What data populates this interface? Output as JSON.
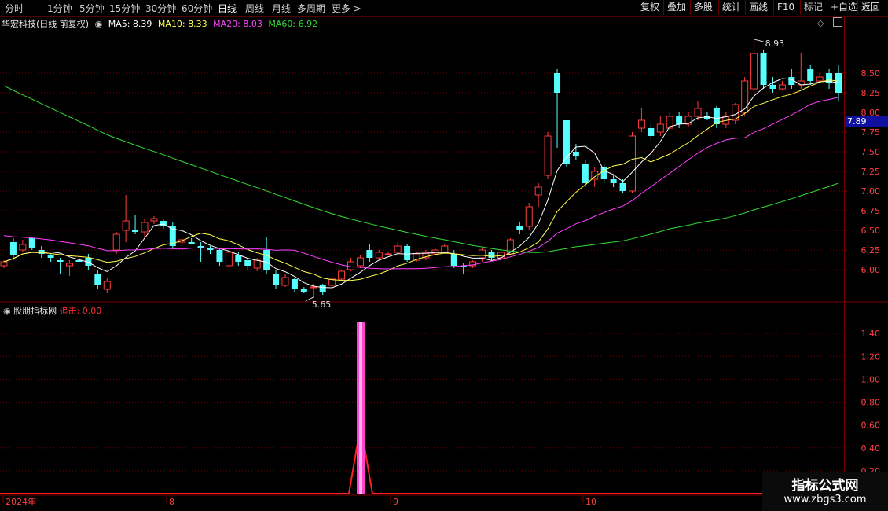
{
  "toolbar": {
    "periods": [
      "分时",
      "1分钟",
      "5分钟",
      "15分钟",
      "30分钟",
      "60分钟",
      "日线",
      "周线",
      "月线",
      "多周期",
      "更多 >"
    ],
    "active_period": "日线",
    "actions": [
      "复权",
      "叠加",
      "多股",
      "统计",
      "画线",
      "F10",
      "标记",
      "+自选",
      "返回"
    ]
  },
  "legend": {
    "stock": "华宏科技(日线 前复权)",
    "ma5": "MA5: 8.39",
    "ma10": "MA10: 8.33",
    "ma20": "MA20: 8.03",
    "ma60": "MA60: 6.92"
  },
  "indicator": {
    "name": "股朋指标网",
    "value": "追击: 0.00"
  },
  "price_axis": [
    "8.50",
    "8.25",
    "8.00",
    "7.75",
    "7.50",
    "7.25",
    "7.00",
    "6.75",
    "6.50",
    "6.25",
    "6.00"
  ],
  "current_price": "7.89",
  "high_label": "8.93",
  "low_label": "5.65",
  "ind_axis": [
    "1.40",
    "1.20",
    "1.00",
    "0.80",
    "0.60",
    "0.40",
    "0.20"
  ],
  "date_labels": [
    "2024年",
    "8",
    "9",
    "10"
  ],
  "watermark": {
    "line1": "指标公式网",
    "line2": "www.zbgs3.com"
  },
  "colors": {
    "up": "#ff3c3c",
    "down": "#54ffff",
    "ma5": "#ffffff",
    "ma10": "#ffff4c",
    "ma20": "#ff40ff",
    "ma60": "#33dd33",
    "grid": "#7a0000",
    "pulse": "#ff44cc"
  },
  "chart_data": {
    "type": "candlestick",
    "price_range": [
      5.6,
      9.05
    ],
    "candles": [
      [
        6.05,
        6.1,
        6.02,
        6.12
      ],
      [
        6.35,
        6.18,
        6.12,
        6.4
      ],
      [
        6.25,
        6.32,
        6.22,
        6.38
      ],
      [
        6.4,
        6.28,
        6.25,
        6.42
      ],
      [
        6.25,
        6.2,
        6.15,
        6.3
      ],
      [
        6.18,
        6.15,
        6.1,
        6.2
      ],
      [
        6.12,
        6.1,
        5.95,
        6.15
      ],
      [
        6.05,
        6.08,
        5.92,
        6.12
      ],
      [
        6.12,
        6.1,
        6.05,
        6.15
      ],
      [
        6.15,
        6.05,
        6.0,
        6.2
      ],
      [
        5.95,
        5.8,
        5.75,
        6.0
      ],
      [
        5.75,
        5.85,
        5.7,
        5.9
      ],
      [
        6.25,
        6.45,
        6.2,
        6.48
      ],
      [
        6.5,
        6.62,
        6.35,
        6.95
      ],
      [
        6.5,
        6.48,
        6.45,
        6.7
      ],
      [
        6.48,
        6.6,
        6.4,
        6.65
      ],
      [
        6.62,
        6.65,
        6.58,
        6.68
      ],
      [
        6.62,
        6.55,
        6.52,
        6.65
      ],
      [
        6.55,
        6.3,
        6.28,
        6.6
      ],
      [
        6.35,
        6.38,
        6.3,
        6.4
      ],
      [
        6.35,
        6.33,
        6.32,
        6.4
      ],
      [
        6.3,
        6.28,
        6.1,
        6.35
      ],
      [
        6.28,
        6.25,
        6.2,
        6.3
      ],
      [
        6.25,
        6.1,
        6.05,
        6.28
      ],
      [
        6.05,
        6.22,
        6.0,
        6.25
      ],
      [
        6.18,
        6.1,
        6.05,
        6.22
      ],
      [
        6.12,
        6.05,
        6.0,
        6.15
      ],
      [
        6.02,
        6.12,
        5.98,
        6.15
      ],
      [
        6.25,
        6.0,
        5.95,
        6.42
      ],
      [
        5.95,
        5.8,
        5.75,
        6.0
      ],
      [
        5.8,
        5.9,
        5.78,
        5.95
      ],
      [
        5.88,
        5.75,
        5.72,
        5.9
      ],
      [
        5.75,
        5.72,
        5.7,
        5.78
      ],
      [
        5.78,
        5.78,
        5.65,
        5.82
      ],
      [
        5.8,
        5.72,
        5.68,
        5.82
      ],
      [
        5.8,
        5.88,
        5.75,
        5.9
      ],
      [
        5.88,
        5.98,
        5.85,
        6.0
      ],
      [
        6.0,
        6.1,
        5.98,
        6.15
      ],
      [
        6.05,
        6.15,
        6.02,
        6.18
      ],
      [
        6.25,
        6.15,
        6.1,
        6.32
      ],
      [
        6.15,
        6.22,
        6.12,
        6.25
      ],
      [
        6.2,
        6.2,
        6.18,
        6.22
      ],
      [
        6.22,
        6.3,
        6.2,
        6.35
      ],
      [
        6.3,
        6.12,
        6.1,
        6.32
      ],
      [
        6.12,
        6.2,
        6.1,
        6.22
      ],
      [
        6.15,
        6.22,
        6.12,
        6.25
      ],
      [
        6.2,
        6.25,
        6.18,
        6.28
      ],
      [
        6.22,
        6.3,
        6.2,
        6.32
      ],
      [
        6.2,
        6.05,
        6.02,
        6.25
      ],
      [
        6.05,
        6.03,
        5.95,
        6.08
      ],
      [
        6.05,
        6.1,
        6.02,
        6.12
      ],
      [
        6.15,
        6.25,
        6.1,
        6.28
      ],
      [
        6.22,
        6.15,
        6.12,
        6.25
      ],
      [
        6.15,
        6.22,
        6.12,
        6.25
      ],
      [
        6.2,
        6.38,
        6.18,
        6.4
      ],
      [
        6.55,
        6.5,
        6.45,
        6.6
      ],
      [
        6.55,
        6.8,
        6.5,
        6.85
      ],
      [
        6.95,
        7.05,
        6.8,
        7.1
      ],
      [
        7.2,
        7.7,
        7.15,
        7.75
      ],
      [
        8.5,
        8.25,
        7.55,
        8.55
      ],
      [
        7.9,
        7.35,
        7.3,
        7.9
      ],
      [
        7.5,
        7.45,
        7.4,
        7.6
      ],
      [
        7.35,
        7.1,
        7.05,
        7.4
      ],
      [
        7.15,
        7.25,
        7.05,
        7.3
      ],
      [
        7.3,
        7.15,
        7.1,
        7.35
      ],
      [
        7.15,
        7.1,
        7.05,
        7.2
      ],
      [
        7.1,
        7.0,
        6.98,
        7.15
      ],
      [
        7.0,
        7.7,
        6.98,
        7.75
      ],
      [
        7.8,
        7.9,
        7.75,
        8.05
      ],
      [
        7.8,
        7.7,
        7.65,
        7.85
      ],
      [
        7.75,
        7.85,
        7.7,
        7.95
      ],
      [
        7.8,
        7.95,
        7.78,
        8.0
      ],
      [
        7.95,
        7.85,
        7.8,
        8.0
      ],
      [
        7.85,
        7.95,
        7.82,
        8.0
      ],
      [
        7.95,
        8.05,
        7.9,
        8.15
      ],
      [
        7.95,
        7.92,
        7.9,
        8.0
      ],
      [
        8.05,
        7.85,
        7.8,
        8.08
      ],
      [
        7.85,
        7.95,
        7.8,
        8.0
      ],
      [
        7.9,
        8.1,
        7.85,
        8.12
      ],
      [
        8.0,
        8.4,
        7.95,
        8.45
      ],
      [
        8.3,
        8.75,
        8.25,
        8.93
      ],
      [
        8.75,
        8.35,
        8.3,
        8.8
      ],
      [
        8.35,
        8.3,
        8.25,
        8.45
      ],
      [
        8.3,
        8.35,
        8.28,
        8.4
      ],
      [
        8.45,
        8.35,
        8.3,
        8.55
      ],
      [
        8.35,
        8.4,
        8.3,
        8.75
      ],
      [
        8.55,
        8.4,
        8.35,
        8.6
      ],
      [
        8.4,
        8.45,
        8.38,
        8.5
      ],
      [
        8.5,
        8.38,
        8.3,
        8.55
      ],
      [
        8.5,
        8.25,
        8.15,
        8.6
      ]
    ],
    "ma5_end": 8.39,
    "ma10_end": 8.33,
    "ma20_end": 8.03,
    "ma60_end": 6.92,
    "indicator_range": [
      0,
      1.6
    ],
    "indicator_pulse_value": 1.5
  }
}
